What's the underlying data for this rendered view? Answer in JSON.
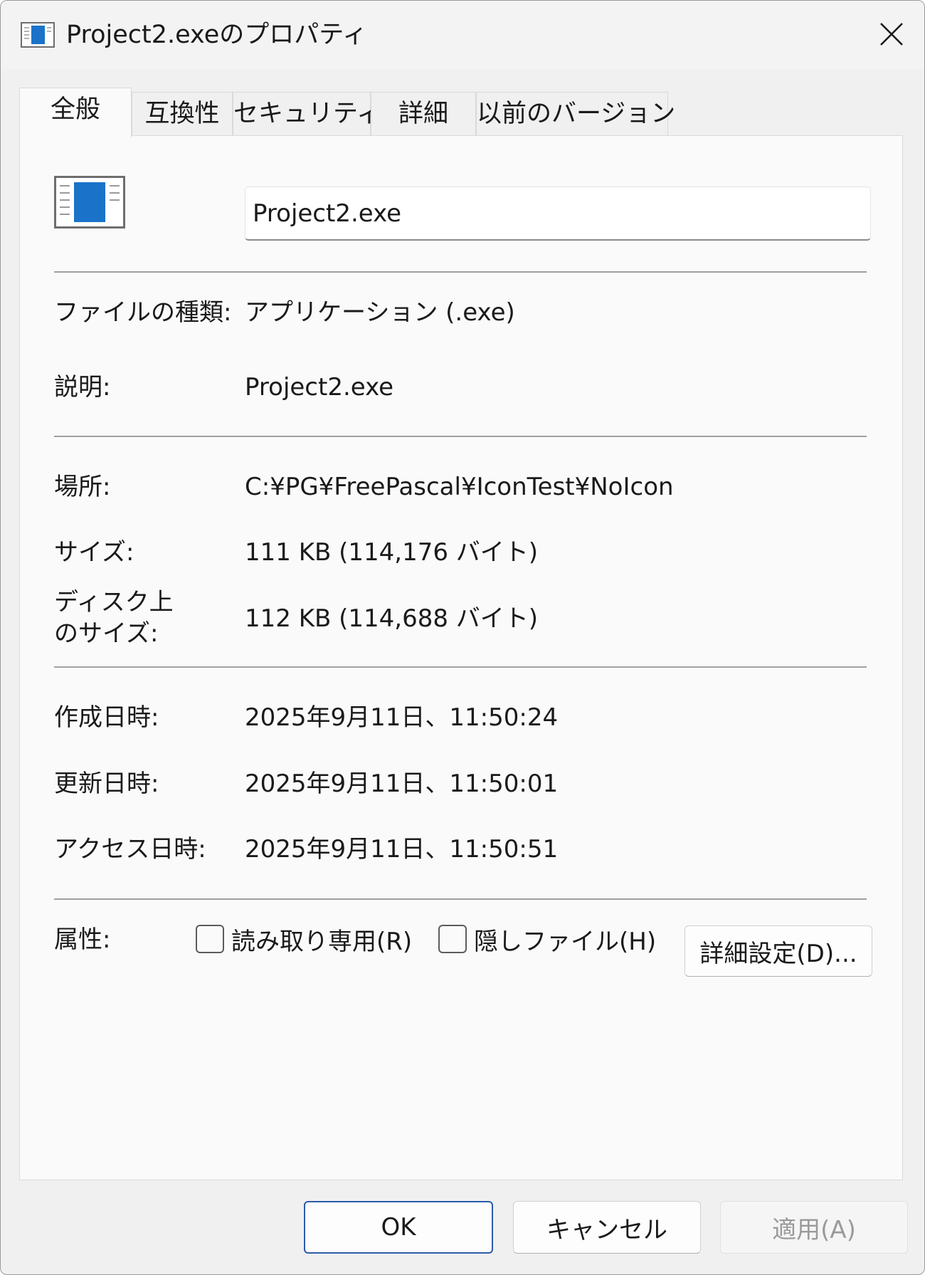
{
  "window": {
    "title": "Project2.exeのプロパティ",
    "close_icon": "close-icon"
  },
  "tabs": [
    {
      "label": "全般",
      "active": true
    },
    {
      "label": "互換性",
      "active": false
    },
    {
      "label": "セキュリティ",
      "active": false
    },
    {
      "label": "詳細",
      "active": false
    },
    {
      "label": "以前のバージョン",
      "active": false
    }
  ],
  "general": {
    "file_icon": "application-window-icon",
    "file_name": "Project2.exe",
    "file_type_label": "ファイルの種類:",
    "file_type_value": "アプリケーション (.exe)",
    "description_label": "説明:",
    "description_value": "Project2.exe",
    "location_label": "場所:",
    "location_value": "C:¥PG¥FreePascal¥IconTest¥NoIcon",
    "size_label": "サイズ:",
    "size_value": "111 KB (114,176 バイト)",
    "disk_size_label_line1": "ディスク上",
    "disk_size_label_line2": "のサイズ:",
    "disk_size_value": "112 KB (114,688 バイト)",
    "created_label": "作成日時:",
    "created_value": "2025年9月11日、11:50:24",
    "modified_label": "更新日時:",
    "modified_value": "2025年9月11日、11:50:01",
    "accessed_label": "アクセス日時:",
    "accessed_value": "2025年9月11日、11:50:51",
    "attributes_label": "属性:",
    "readonly_label": "読み取り専用(R)",
    "readonly_checked": false,
    "hidden_label": "隠しファイル(H)",
    "hidden_checked": false,
    "advanced_button": "詳細設定(D)..."
  },
  "footer": {
    "ok_label": "OK",
    "cancel_label": "キャンセル",
    "apply_label": "適用(A)",
    "apply_enabled": false
  },
  "colors": {
    "accent": "#2a5caa",
    "icon_blue": "#1a73c9"
  }
}
